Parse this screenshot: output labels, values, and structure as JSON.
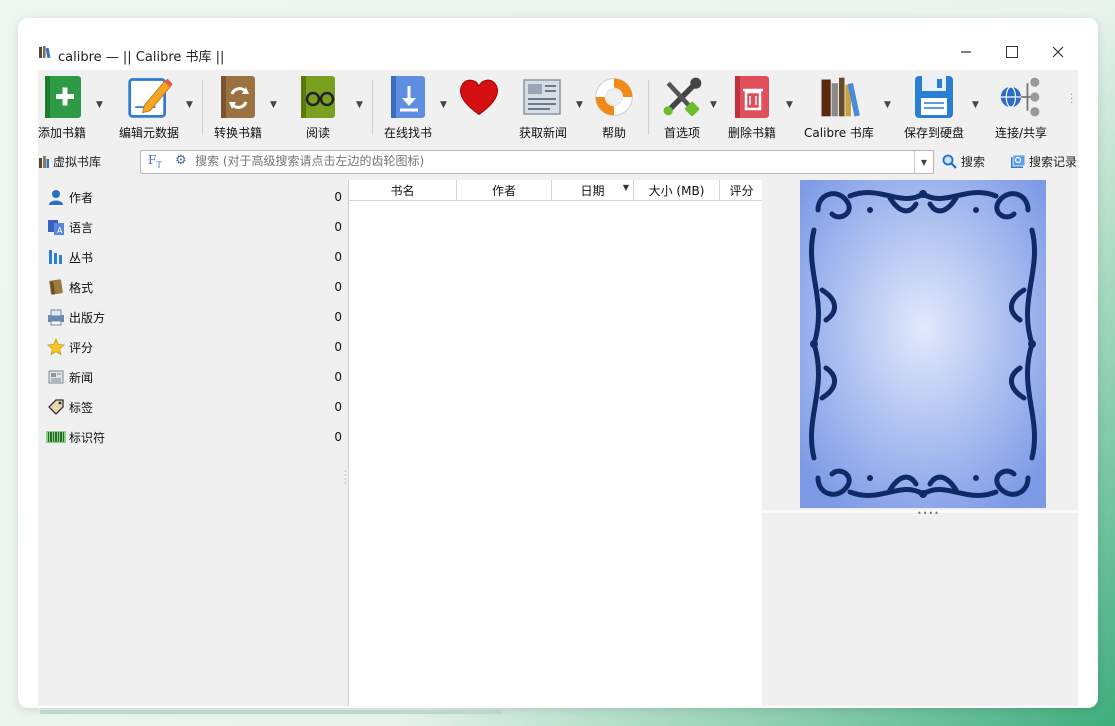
{
  "window": {
    "title": "calibre — || Calibre 书库 ||"
  },
  "toolbar": {
    "items": [
      {
        "label": "添加书籍",
        "icon": "add-book-icon",
        "has_menu": true
      },
      {
        "label": "编辑元数据",
        "icon": "edit-metadata-icon",
        "has_menu": true
      },
      {
        "label": "转换书籍",
        "icon": "convert-books-icon",
        "has_menu": true
      },
      {
        "label": "阅读",
        "icon": "read-icon",
        "has_menu": true
      },
      {
        "label": "在线找书",
        "icon": "get-books-icon",
        "has_menu": true
      },
      {
        "label": "",
        "icon": "donate-heart-icon",
        "has_menu": false
      },
      {
        "label": "获取新闻",
        "icon": "fetch-news-icon",
        "has_menu": true
      },
      {
        "label": "帮助",
        "icon": "help-lifebuoy-icon",
        "has_menu": false
      },
      {
        "label": "首选项",
        "icon": "preferences-tools-icon",
        "has_menu": true
      },
      {
        "label": "删除书籍",
        "icon": "remove-books-icon",
        "has_menu": true
      },
      {
        "label": "Calibre 书库",
        "icon": "library-books-icon",
        "has_menu": true
      },
      {
        "label": "保存到硬盘",
        "icon": "save-to-disk-icon",
        "has_menu": true
      },
      {
        "label": "连接/共享",
        "icon": "connect-share-icon",
        "has_menu": false
      }
    ]
  },
  "searchbar": {
    "virtual_library": "虚拟书库",
    "placeholder": "搜索 (对于高级搜索请点击左边的齿轮图标)",
    "search_button": "搜索",
    "history_button": "搜索记录"
  },
  "tag_browser": {
    "items": [
      {
        "label": "作者",
        "count": "0",
        "icon": "person-icon"
      },
      {
        "label": "语言",
        "count": "0",
        "icon": "languages-icon"
      },
      {
        "label": "丛书",
        "count": "0",
        "icon": "series-icon"
      },
      {
        "label": "格式",
        "count": "0",
        "icon": "book-format-icon"
      },
      {
        "label": "出版方",
        "count": "0",
        "icon": "publisher-icon"
      },
      {
        "label": "评分",
        "count": "0",
        "icon": "star-icon"
      },
      {
        "label": "新闻",
        "count": "0",
        "icon": "news-icon"
      },
      {
        "label": "标签",
        "count": "0",
        "icon": "tag-icon"
      },
      {
        "label": "标识符",
        "count": "0",
        "icon": "barcode-icon"
      }
    ]
  },
  "book_list": {
    "columns": [
      "书名",
      "作者",
      "日期",
      "大小 (MB)",
      "评分"
    ],
    "sort_column": "日期"
  },
  "colors": {
    "accent": "#1e6fd0",
    "cover_bg": "#8aa6ec",
    "cover_ornament": "#0f2a66"
  }
}
